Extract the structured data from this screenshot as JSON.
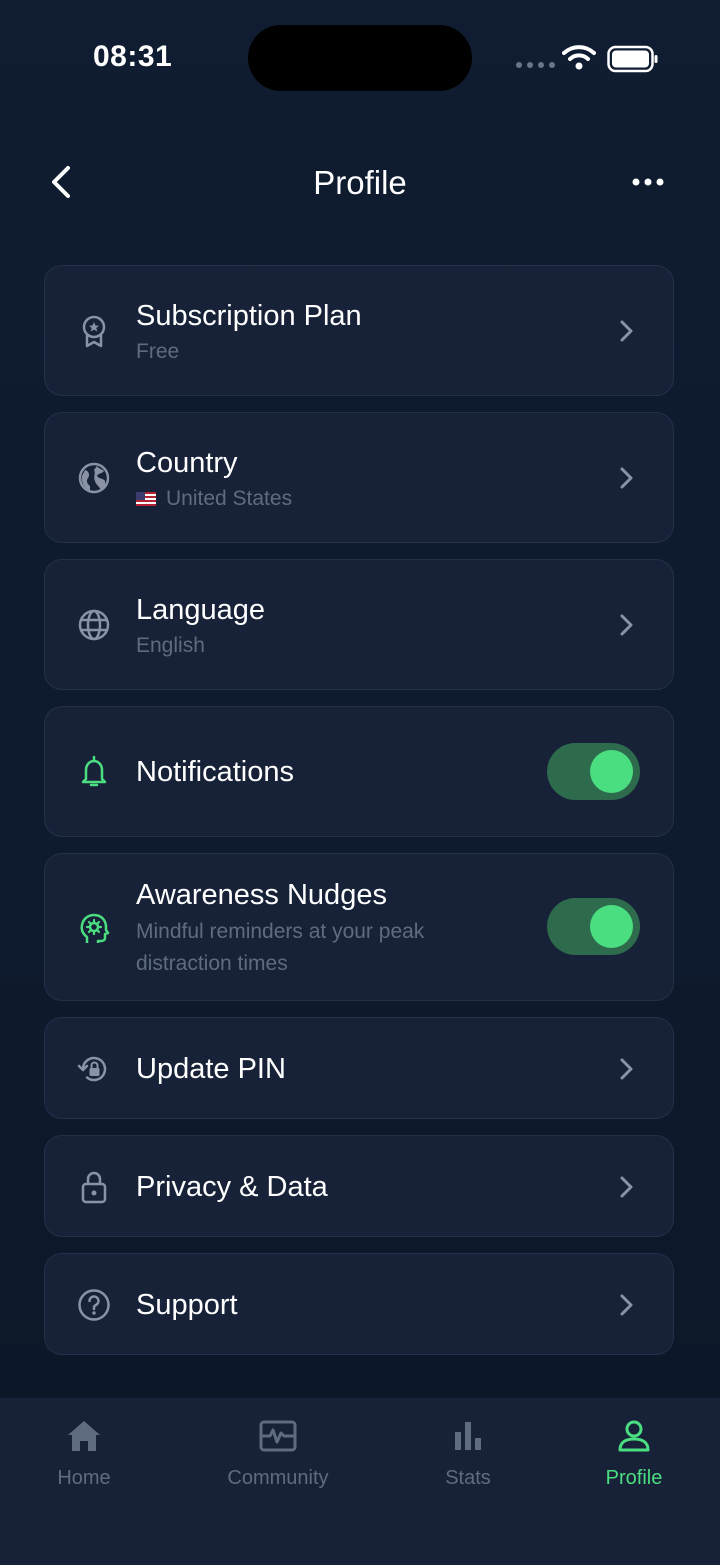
{
  "status_bar": {
    "time": "08:31"
  },
  "header": {
    "title": "Profile"
  },
  "items": [
    {
      "label": "Subscription Plan",
      "sub": "Free"
    },
    {
      "label": "Country",
      "sub": "United States"
    },
    {
      "label": "Language",
      "sub": "English"
    },
    {
      "label": "Notifications",
      "toggle_on": true
    },
    {
      "label": "Awareness Nudges",
      "sub_line1": "Mindful reminders at your peak",
      "sub_line2": "distraction times",
      "toggle_on": true
    },
    {
      "label": "Update PIN"
    },
    {
      "label": "Privacy & Data"
    },
    {
      "label": "Support"
    }
  ],
  "tabs": [
    {
      "label": "Home",
      "icon": "home-icon"
    },
    {
      "label": "Community",
      "icon": "community-icon"
    },
    {
      "label": "Stats",
      "icon": "stats-icon"
    },
    {
      "label": "Profile",
      "icon": "profile-icon",
      "active": true
    }
  ],
  "colors": {
    "background": "#0f1c31",
    "card": "#172238",
    "accent": "#4ade80",
    "toggle_track": "#2d6b4c",
    "muted": "#5f6b80"
  }
}
